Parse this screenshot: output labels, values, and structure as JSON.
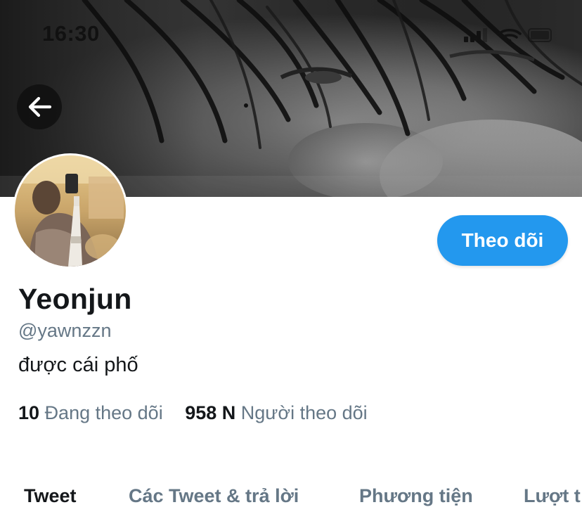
{
  "status_bar": {
    "time": "16:30",
    "icons": [
      "signal-icon",
      "wifi-icon",
      "battery-icon"
    ]
  },
  "header": {
    "back_icon": "arrow-left-icon"
  },
  "profile": {
    "display_name": "Yeonjun",
    "handle": "@yawnzzn",
    "bio": "được cái phố",
    "follow_label": "Theo dõi",
    "following_count": "10",
    "following_label": "Đang theo dõi",
    "followers_count": "958 N",
    "followers_label": "Người theo dõi"
  },
  "tabs": [
    {
      "label": "Tweet",
      "active": true
    },
    {
      "label": "Các Tweet & trả lời",
      "active": false
    },
    {
      "label": "Phương tiện",
      "active": false
    },
    {
      "label": "Lượt t",
      "active": false
    }
  ],
  "colors": {
    "accent": "#1d9bf0",
    "text_primary": "#14171a",
    "text_secondary": "#657786"
  }
}
